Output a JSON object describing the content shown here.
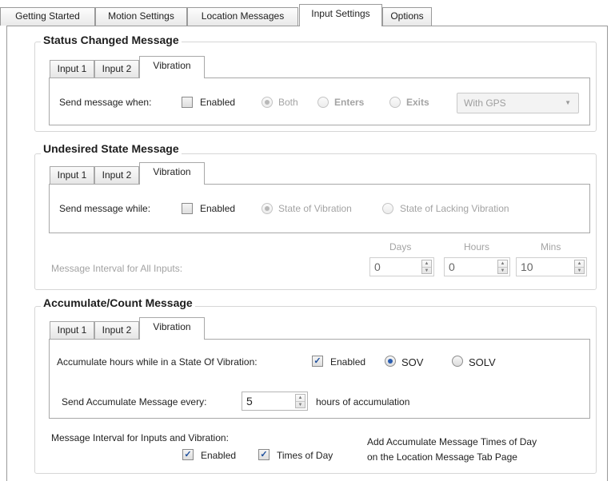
{
  "tabs": [
    {
      "label": "Getting Started"
    },
    {
      "label": "Motion Settings"
    },
    {
      "label": "Location Messages"
    },
    {
      "label": "Input Settings",
      "active": true
    },
    {
      "label": "Options"
    }
  ],
  "status_changed": {
    "title": "Status Changed Message",
    "tabs": [
      "Input 1",
      "Input 2",
      "Vibration"
    ],
    "send_when_label": "Send message when:",
    "enabled_label": "Enabled",
    "enabled_checked": false,
    "radio_both": "Both",
    "radio_enters": "Enters",
    "radio_exits": "Exits",
    "dropdown_value": "With GPS"
  },
  "undesired_state": {
    "title": "Undesired State Message",
    "tabs": [
      "Input 1",
      "Input 2",
      "Vibration"
    ],
    "send_while_label": "Send message while:",
    "enabled_label": "Enabled",
    "enabled_checked": false,
    "radio_sov": "State of Vibration",
    "radio_solv": "State of Lacking Vibration",
    "interval_label": "Message Interval for All Inputs:",
    "days_label": "Days",
    "hours_label": "Hours",
    "mins_label": "Mins",
    "days_value": "0",
    "hours_value": "0",
    "mins_value": "10"
  },
  "accumulate": {
    "title": "Accumulate/Count Message",
    "tabs": [
      "Input 1",
      "Input 2",
      "Vibration"
    ],
    "accumulate_label": "Accumulate hours while in a State Of Vibration:",
    "enabled_label": "Enabled",
    "enabled_checked": true,
    "radio_sov": "SOV",
    "radio_solv": "SOLV",
    "send_every_label": "Send Accumulate Message every:",
    "every_value": "5",
    "hours_accum_label": "hours of accumulation",
    "interval_label": "Message Interval for Inputs and Vibration:",
    "interval_enabled_label": "Enabled",
    "times_of_day_label": "Times of Day",
    "note_line1": "Add Accumulate Message Times of Day",
    "note_line2": "on the Location Message Tab Page"
  },
  "colors": {
    "radio_dot": "#2a5db0",
    "check": "#1e4f9c",
    "disabled_text": "#a3a3a3"
  }
}
